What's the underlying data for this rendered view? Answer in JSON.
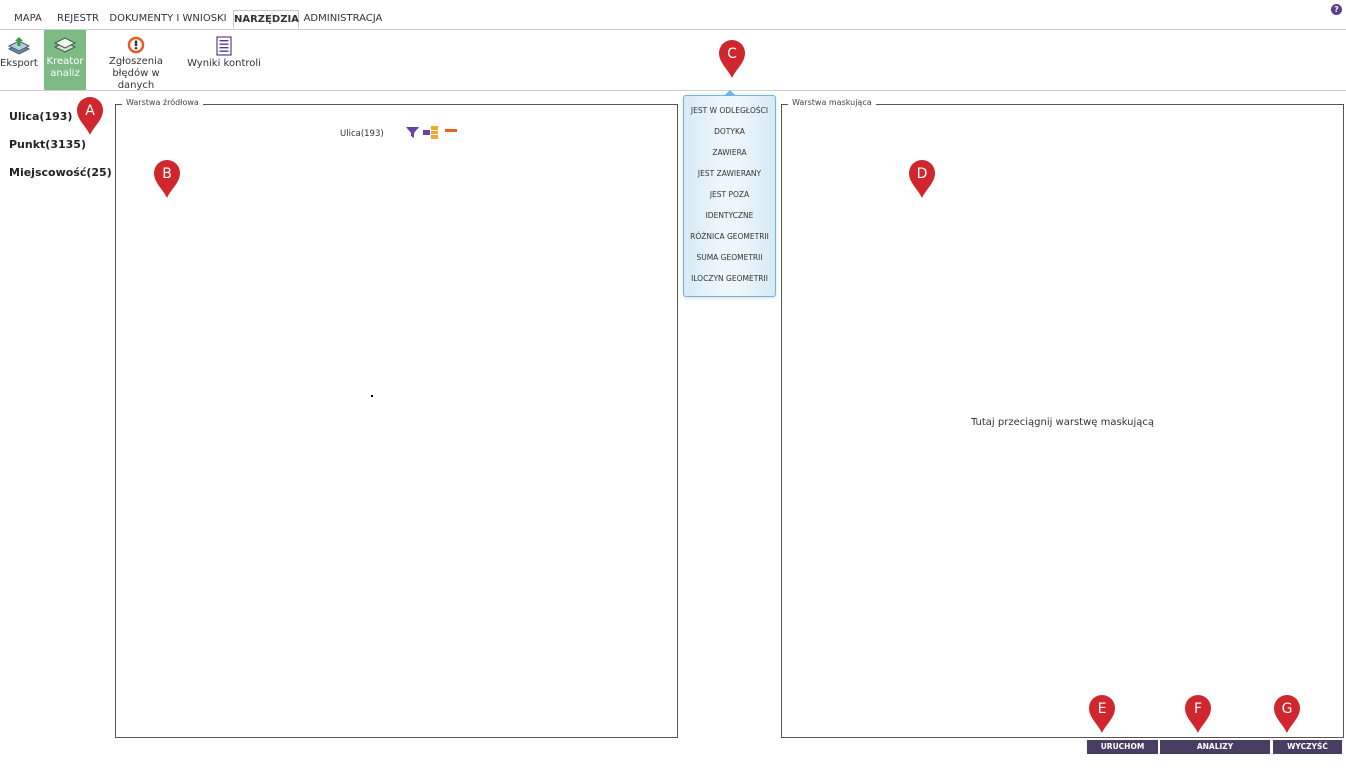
{
  "menu": {
    "tabs": [
      "MAPA",
      "REJESTR",
      "DOKUMENTY I WNIOSKI",
      "NARZĘDZIA",
      "ADMINISTRACJA"
    ],
    "active": "NARZĘDZIA",
    "help": "?"
  },
  "toolbar": {
    "eksport": "Eksport",
    "kreator_line1": "Kreator",
    "kreator_line2": "analiz",
    "zgloszenia_line1": "Zgłoszenia",
    "zgloszenia_line2": "błędów w danych",
    "wyniki": "Wyniki kontroli"
  },
  "layers": [
    "Ulica(193)",
    "Punkt(3135)",
    "Miejscowość(25)"
  ],
  "source": {
    "legend": "Warstwa źródłowa",
    "layer": "Ulica(193)"
  },
  "operations": [
    "JEST W ODLEGŁOŚCI",
    "DOTYKA",
    "ZAWIERA",
    "JEST ZAWIERANY",
    "JEST POZA",
    "IDENTYCZNE",
    "RÓŻNICA GEOMETRII",
    "SUMA GEOMETRII",
    "ILOCZYN GEOMETRII"
  ],
  "mask": {
    "legend": "Warstwa maskująca",
    "placeholder": "Tutaj przeciągnij warstwę maskującą"
  },
  "buttons": {
    "run": "URUCHOM",
    "predefined": "ANALIZY PREDEFINIOWANE",
    "clear": "WYCZYŚĆ WYNIK"
  },
  "markers": [
    "A",
    "B",
    "C",
    "D",
    "E",
    "F",
    "G"
  ],
  "colors": {
    "active_tool": "#7dba84",
    "marker": "#d0262d",
    "button": "#4a3d63",
    "ops_border": "#6fb6e0"
  }
}
